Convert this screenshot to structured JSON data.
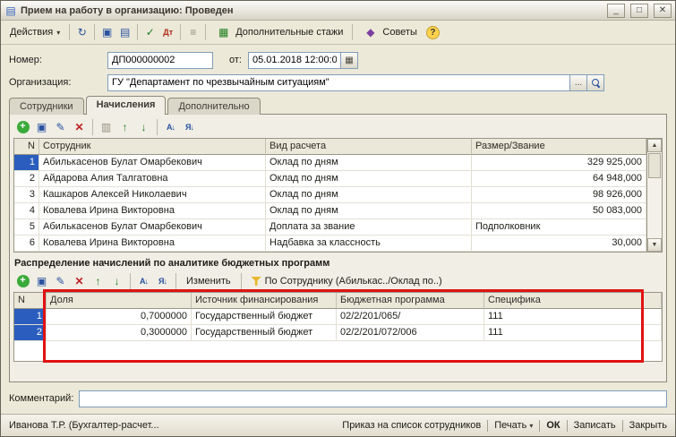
{
  "icons": {
    "doc": "▤",
    "minimize": "_",
    "maximize": "□",
    "close": "✕",
    "dropdown": "▾",
    "refresh": "↻",
    "copy": "▣",
    "save": "▤",
    "post": "✓",
    "dtkt": "Дт",
    "structure": "≡",
    "stazhi": "▦",
    "tips": "◆",
    "help": "?",
    "calendar": "▦",
    "add": "+",
    "copy_row": "▣",
    "edit": "✎",
    "delete": "✕",
    "end_edit": "▥",
    "move_up": "↑",
    "move_down": "↓",
    "sort_az": "А↓",
    "sort_za": "Я↓",
    "scroll_up": "▲",
    "scroll_down": "▼"
  },
  "window": {
    "title": "Прием на работу в организацию: Проведен"
  },
  "toolbar": {
    "actions": "Действия",
    "stazhi": "Дополнительные стажи",
    "tips": "Советы"
  },
  "form": {
    "number_label": "Номер:",
    "number_value": "ДП000000002",
    "date_label": "от:",
    "date_value": "05.01.2018 12:00:00",
    "org_label": "Организация:",
    "org_value": "ГУ \"Департамент по чрезвычайным ситуациям\"",
    "org_more": "...",
    "comment_label": "Комментарий:",
    "comment_value": ""
  },
  "tabs": [
    {
      "label": "Сотрудники"
    },
    {
      "label": "Начисления"
    },
    {
      "label": "Дополнительно"
    }
  ],
  "employees_table": {
    "columns": [
      "N",
      "Сотрудник",
      "Вид расчета",
      "Размер/Звание"
    ],
    "rows": [
      {
        "n": "1",
        "employee": "Абилькасенов Булат Омарбекович",
        "calc": "Оклад по дням",
        "size": "329 925,000"
      },
      {
        "n": "2",
        "employee": "Айдарова Алия Талгатовна",
        "calc": "Оклад по дням",
        "size": "64 948,000"
      },
      {
        "n": "3",
        "employee": "Кашкаров Алексей Николаевич",
        "calc": "Оклад по дням",
        "size": "98 926,000"
      },
      {
        "n": "4",
        "employee": "Ковалева Ирина Викторовна",
        "calc": "Оклад по дням",
        "size": "50 083,000"
      },
      {
        "n": "5",
        "employee": "Абилькасенов Булат Омарбекович",
        "calc": "Доплата за звание",
        "size": "Подполковник"
      },
      {
        "n": "6",
        "employee": "Ковалева Ирина Викторовна",
        "calc": "Надбавка за классность",
        "size": "30,000"
      }
    ]
  },
  "section_title": "Распределение начислений по аналитике бюджетных программ",
  "alloc_toolbar": {
    "edit": "Изменить",
    "filter": "По Сотруднику (Абилькас../Оклад по..)"
  },
  "alloc_table": {
    "columns": [
      "N",
      "Доля",
      "Источник финансирования",
      "Бюджетная программа",
      "Специфика"
    ],
    "rows": [
      {
        "n": "1",
        "share": "0,7000000",
        "source": "Государственный бюджет",
        "program": "02/2/201/065/",
        "spec": "111"
      },
      {
        "n": "2",
        "share": "0,3000000",
        "source": "Государственный бюджет",
        "program": "02/2/201/072/006",
        "spec": "111"
      }
    ]
  },
  "statusbar": {
    "user": "Иванова Т.Р. (Бухгалтер-расчет...",
    "order": "Приказ на список сотрудников",
    "print": "Печать",
    "ok": "ОК",
    "save": "Записать",
    "close": "Закрыть"
  }
}
